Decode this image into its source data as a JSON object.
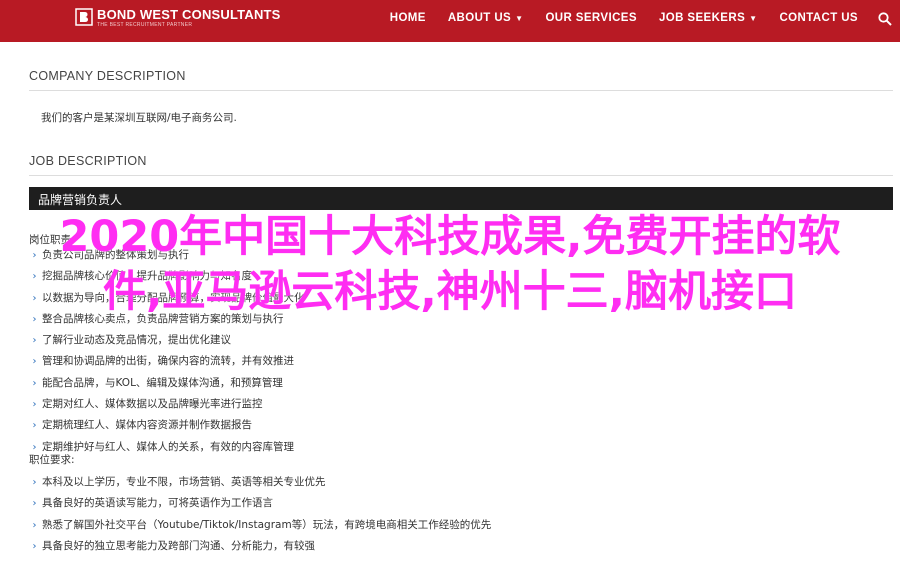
{
  "header": {
    "logo_text": "BOND WEST CONSULTANTS",
    "logo_tag": "THE BEST RECRUITMENT PARTNER",
    "nav": [
      {
        "label": "HOME",
        "has_caret": false
      },
      {
        "label": "ABOUT US",
        "has_caret": true
      },
      {
        "label": "OUR SERVICES",
        "has_caret": false
      },
      {
        "label": "JOB SEEKERS",
        "has_caret": true
      },
      {
        "label": "CONTACT US",
        "has_caret": false
      }
    ],
    "accent_color": "#b81a24"
  },
  "company": {
    "heading": "COMPANY DESCRIPTION",
    "text": "我们的客户是某深圳互联网/电子商务公司."
  },
  "job": {
    "heading": "JOB DESCRIPTION",
    "position": "品牌营销负责人",
    "duties_label": "岗位职责:",
    "duties": [
      "负责公司品牌的整体策划与执行",
      "挖掘品牌核心价值，提升品牌影响力与知名度",
      "以数据为导向，合理分配品牌预算，实现品牌价值最大化",
      "整合品牌核心卖点，负责品牌营销方案的策划与执行",
      "了解行业动态及竞品情况，提出优化建议",
      "管理和协调品牌的出街，确保内容的流转，并有效推进",
      "能配合品牌，与KOL、编辑及媒体沟通，和预算管理",
      "定期对红人、媒体数据以及品牌曝光率进行监控",
      "定期梳理红人、媒体内容资源并制作数据报告",
      "定期维护好与红人、媒体人的关系，有效的内容库管理"
    ],
    "requirements_label": "职位要求:",
    "requirements": [
      "本科及以上学历，专业不限，市场营销、英语等相关专业优先",
      "具备良好的英语读写能力，可将英语作为工作语言",
      "熟悉了解国外社交平台（Youtube/Tiktok/Instagram等）玩法，有跨境电商相关工作经验的优先",
      "具备良好的独立思考能力及跨部门沟通、分析能力，有较强"
    ]
  },
  "overlay": {
    "text": "2020年中国十大科技成果,免费开挂的软件,亚马逊云科技,神州十三,脑机接口",
    "color": "#ff2df2"
  },
  "icons": {
    "search": "search-icon",
    "bullet": "chevron-right-icon"
  }
}
